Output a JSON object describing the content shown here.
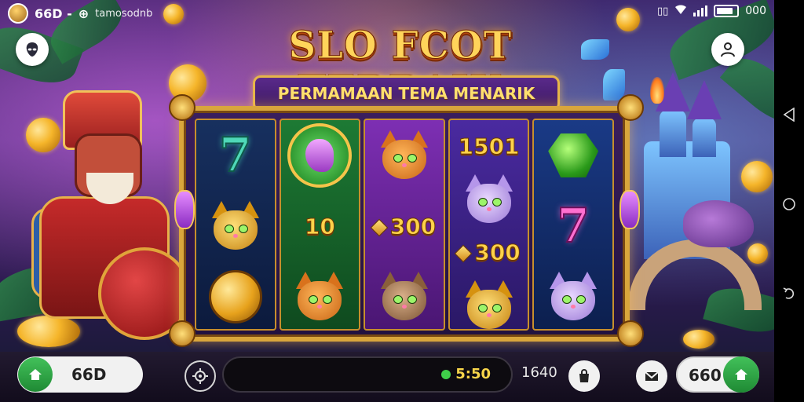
{
  "status_bar": {
    "left_label": "66D -",
    "left_glyph": "⊕",
    "app_text": "tamosodnb",
    "right_text": "000"
  },
  "title": "SLO FCOT TERBAIK",
  "subtitle": "PERMAMAAN TEMA MENARIK",
  "reels": [
    {
      "color": "#17305f",
      "symbols": [
        {
          "type": "seven",
          "text": "7",
          "variant": "teal"
        },
        {
          "type": "cat",
          "variant": "gold"
        },
        {
          "type": "coin",
          "variant": "gold"
        }
      ]
    },
    {
      "color": "#1d7a34",
      "symbols": [
        {
          "type": "green-coin"
        },
        {
          "type": "number",
          "text": "10"
        },
        {
          "type": "cat",
          "variant": "orange"
        }
      ]
    },
    {
      "color": "#7d2fb3",
      "symbols": [
        {
          "type": "cat",
          "variant": "orange"
        },
        {
          "type": "number",
          "text": "300",
          "gem": true
        },
        {
          "type": "cat",
          "variant": "tabby"
        }
      ]
    },
    {
      "color": "#4a2aa0",
      "symbols": [
        {
          "type": "number",
          "text": "1501"
        },
        {
          "type": "cat",
          "variant": "lilac"
        },
        {
          "type": "number",
          "text": "300",
          "gem": true
        },
        {
          "type": "cat",
          "variant": "gold"
        }
      ]
    },
    {
      "color": "#1a3a86",
      "symbols": [
        {
          "type": "gem",
          "variant": "green"
        },
        {
          "type": "seven",
          "text": "7",
          "variant": "pink"
        },
        {
          "type": "cat",
          "variant": "lilac"
        }
      ]
    }
  ],
  "bottom_bar": {
    "home_label": "66D",
    "spin_value": "5:50",
    "center_text": "1640",
    "balance": "660"
  },
  "icons": {
    "top_left": "alien-head-icon",
    "top_right": "user-icon",
    "home": "home-icon",
    "settings": "gear-icon",
    "bag": "bag-icon",
    "mail": "mail-icon",
    "wallet": "home-icon"
  },
  "colors": {
    "title": "#ffd45a",
    "frame": "#d9a63c",
    "accent_green": "#2fa548"
  }
}
